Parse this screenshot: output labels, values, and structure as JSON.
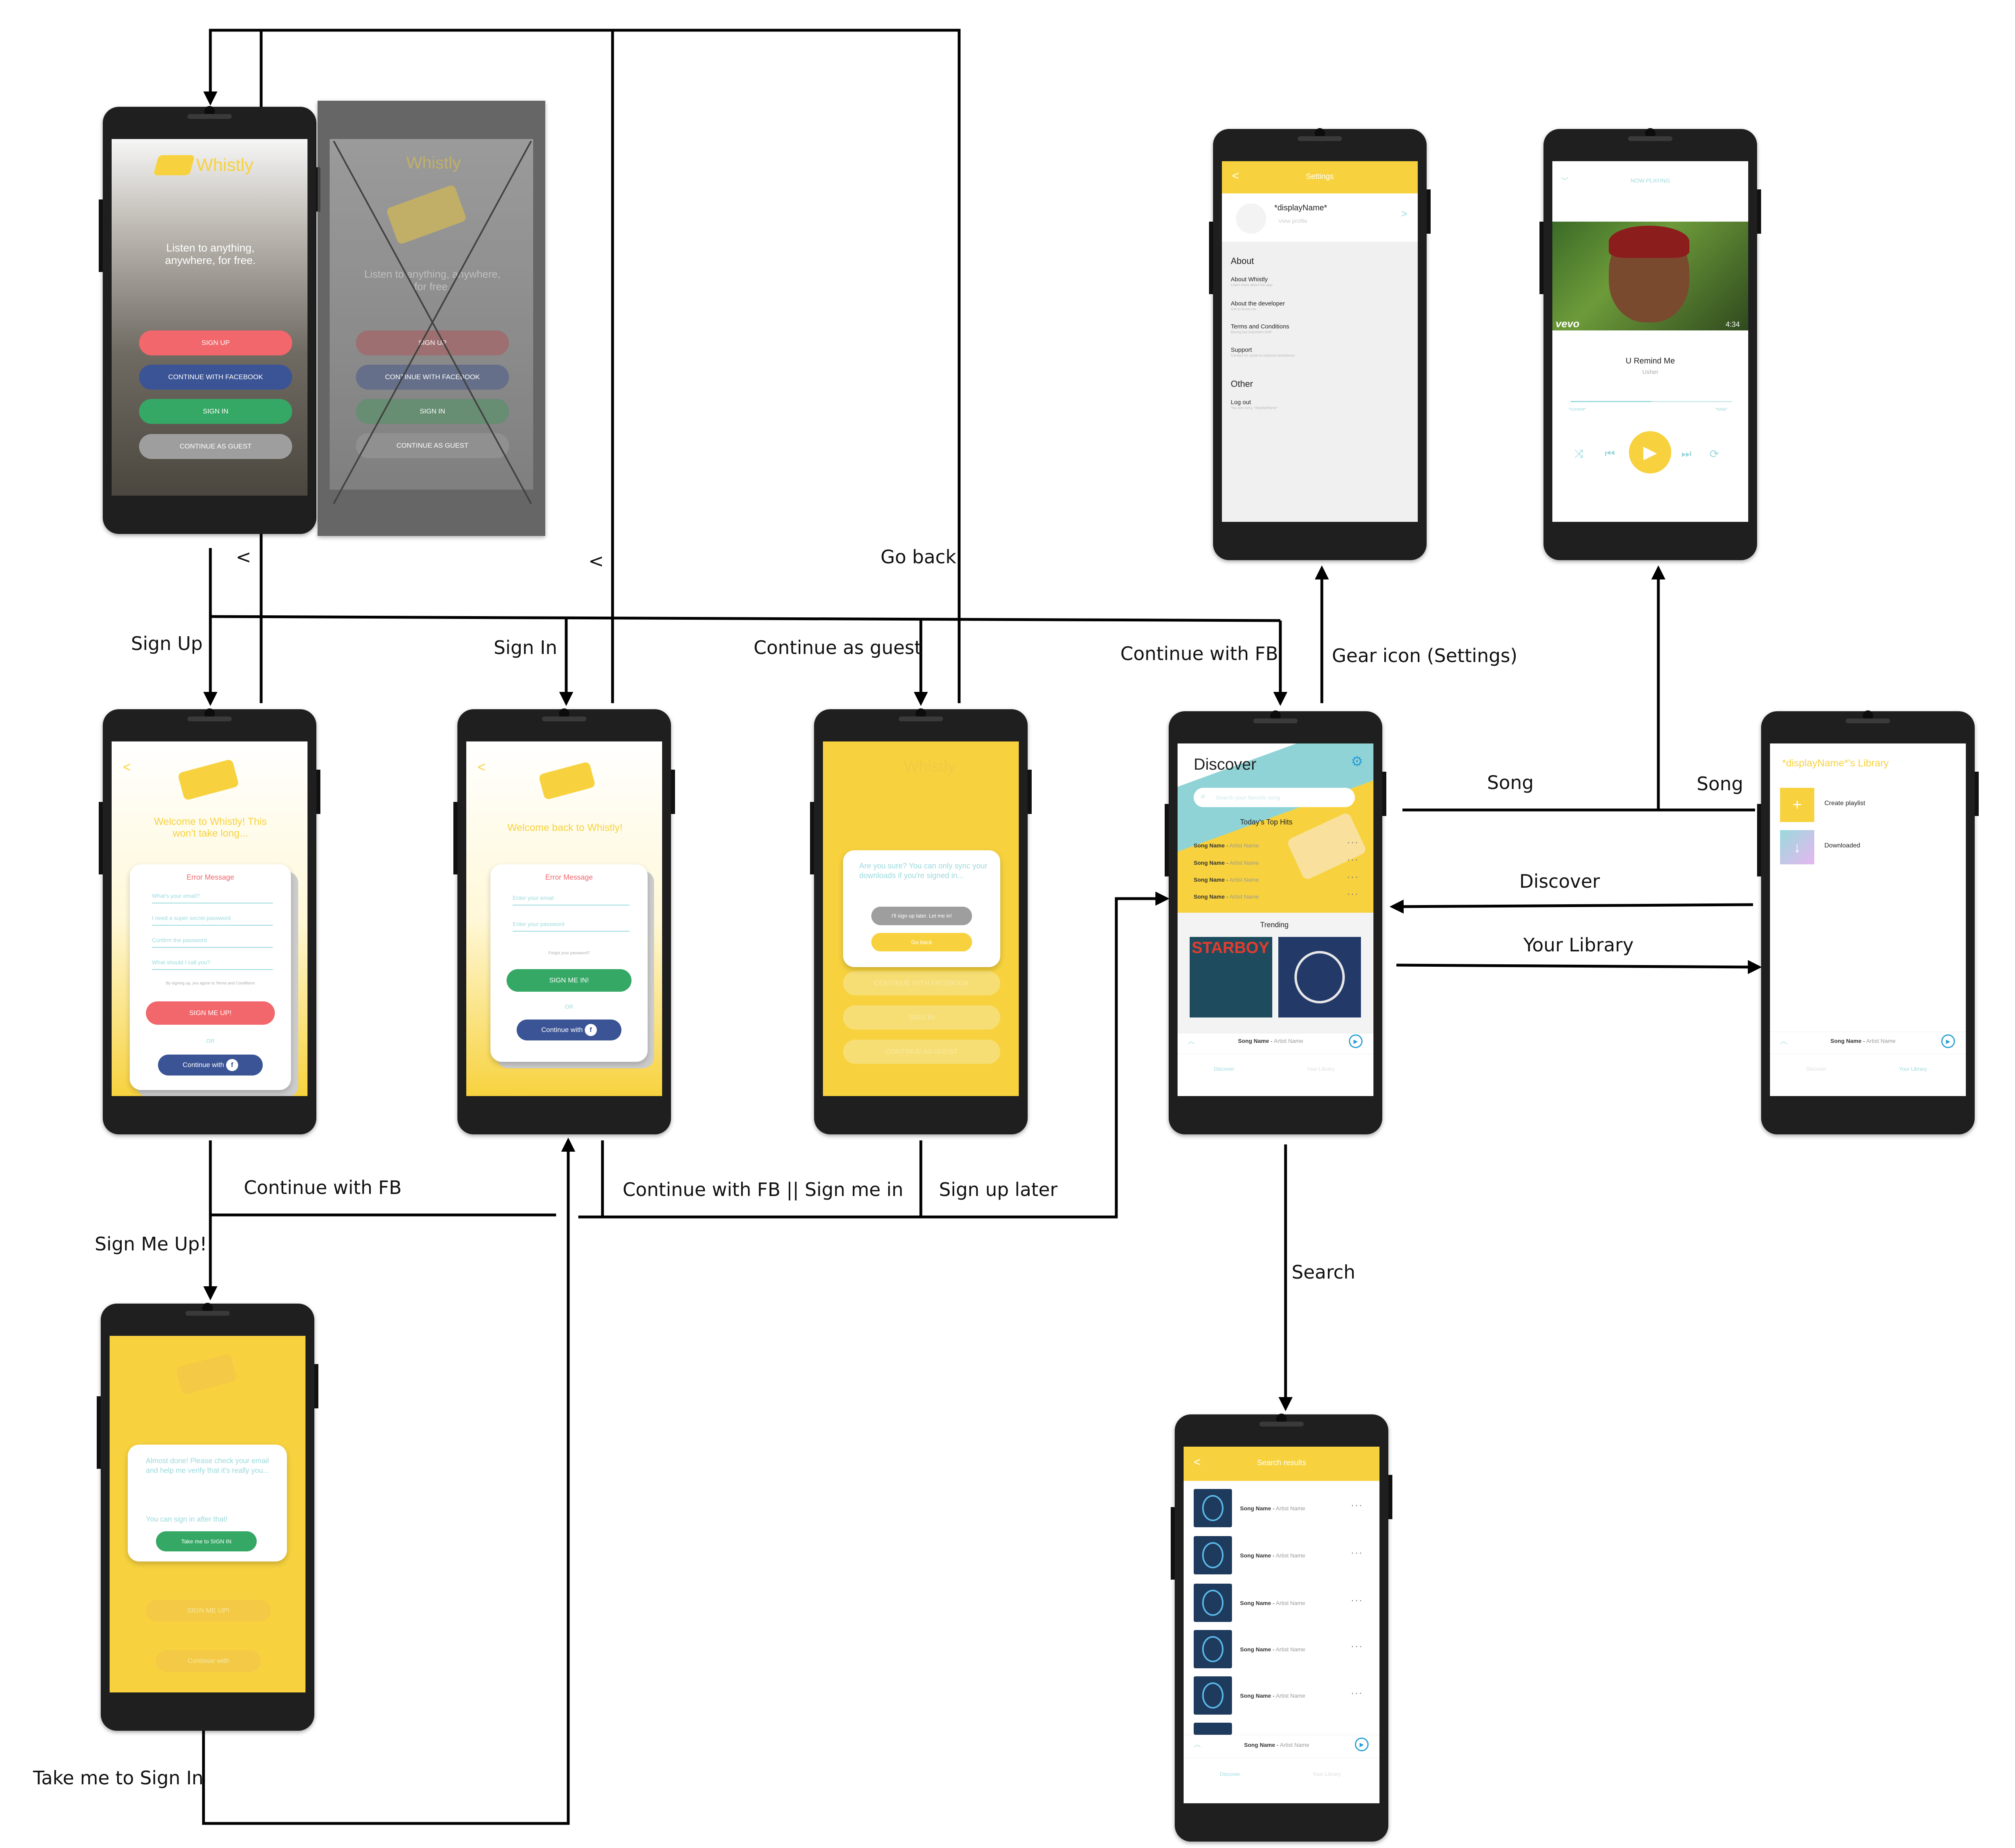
{
  "flow_labels": {
    "back1": "<",
    "back2": "<",
    "go_back": "Go back",
    "sign_up": "Sign Up",
    "sign_in": "Sign In",
    "continue_as_guest": "Continue as guest",
    "continue_with_fb_top": "Continue with FB",
    "gear_icon": "Gear icon (Settings)",
    "song_left": "Song",
    "song_right": "Song",
    "discover": "Discover",
    "your_library": "Your Library",
    "continue_with_fb_bottom": "Continue with FB",
    "sign_me_up": "Sign Me Up!",
    "continue_fb_or_sign_me_in": "Continue with FB || Sign me in",
    "sign_up_later": "Sign up later",
    "search": "Search",
    "take_me_to_sign_in": "Take me to Sign In"
  },
  "landing": {
    "app_name": "Whistly",
    "tagline": "Listen to anything, anywhere, for free.",
    "sign_up": "SIGN UP",
    "continue_facebook": "CONTINUE WITH FACEBOOK",
    "sign_in": "SIGN IN",
    "continue_guest": "CONTINUE AS GUEST"
  },
  "landing_ghost": {
    "app_name": "Whistly",
    "tagline": "Listen to anything, anywhere, for free.",
    "sign_up": "SIGN UP",
    "continue_facebook": "CONTINUE WITH FACEBOOK",
    "sign_in": "SIGN IN",
    "continue_guest": "CONTINUE AS GUEST"
  },
  "signup": {
    "back": "<",
    "welcome": "Welcome to Whistly! This won't take long...",
    "error": "Error Message",
    "email_placeholder": "What's your email?",
    "password_placeholder": "I need a super secret password",
    "confirm_placeholder": "Confirm the password",
    "name_placeholder": "What should I call you?",
    "terms": "By signing up, you agree to Terms and Conditions",
    "submit": "SIGN ME UP!",
    "or": "OR",
    "continue_with": "Continue with"
  },
  "signin": {
    "back": "<",
    "welcome": "Welcome back to Whistly!",
    "error": "Error Message",
    "email_placeholder": "Enter your email",
    "password_placeholder": "Enter your password",
    "forgot": "Forgot your password?",
    "submit": "SIGN ME IN!",
    "or": "OR",
    "continue_with": "Continue with"
  },
  "guest": {
    "app_name": "Whistly",
    "dialog_text": "Are you sure? You can only sync your downloads if you're signed in...",
    "later_btn": "I'll sign up later. Let me in!",
    "back_btn": "Go back",
    "bg_fb": "CONTINUE WITH FACEBOOK",
    "bg_sign_in": "SIGN IN",
    "bg_guest": "CONTINUE AS GUEST"
  },
  "almost_done": {
    "text": "Almost done! Please check your email and help me verify that it's really you...",
    "sub": "You can sign in after that!",
    "button": "Take me to SIGN IN",
    "bg_sign_up": "SIGN ME UP!",
    "bg_continue": "Continue with"
  },
  "discover": {
    "title": "Discover",
    "search_placeholder": "Search your favorite song",
    "top_hits": "Today's Top Hits",
    "hits": [
      {
        "song": "Song Name",
        "artist": "Artist Name"
      },
      {
        "song": "Song Name",
        "artist": "Artist Name"
      },
      {
        "song": "Song Name",
        "artist": "Artist Name"
      },
      {
        "song": "Song Name",
        "artist": "Artist Name"
      }
    ],
    "trending": "Trending",
    "trending_album_1": "STARBOY",
    "now_song": "Song Name",
    "now_artist": "Artist Name",
    "nav_discover": "Discover",
    "nav_library": "Your Library"
  },
  "settings": {
    "title": "Settings",
    "back": "<",
    "display_name": "*displayName*",
    "view_profile": "View profile",
    "about_header": "About",
    "items": [
      {
        "title": "About Whistly",
        "sub": "Learn more about the app"
      },
      {
        "title": "About the developer",
        "sub": "Get to know me"
      },
      {
        "title": "Terms and Conditions",
        "sub": "Boring but important stuff"
      },
      {
        "title": "Support",
        "sub": "Contact for quick-to-respond assistance"
      }
    ],
    "other_header": "Other",
    "logout": "Log out",
    "logout_sub": "You are sorry, *displayName*"
  },
  "now_playing": {
    "header": "NOW PLAYING",
    "video_brand": "vevo",
    "duration": "4:34",
    "song": "U Remind Me",
    "artist": "Usher",
    "current": "*current*",
    "total": "*total*"
  },
  "library": {
    "title": "*displayName*'s Library",
    "create_playlist": "Create playlist",
    "downloaded": "Downloaded",
    "now_song": "Song Name",
    "now_artist": "Artist Name",
    "nav_discover": "Discover",
    "nav_library": "Your Library"
  },
  "search_results": {
    "title": "Search results",
    "back": "<",
    "rows": [
      {
        "song": "Song Name",
        "artist": "Artist Name"
      },
      {
        "song": "Song Name",
        "artist": "Artist Name"
      },
      {
        "song": "Song Name",
        "artist": "Artist Name"
      },
      {
        "song": "Song Name",
        "artist": "Artist Name"
      },
      {
        "song": "Song Name",
        "artist": "Artist Name"
      }
    ],
    "now_song": "Song Name",
    "now_artist": "Artist Name",
    "nav_discover": "Discover",
    "nav_library": "Your Library"
  },
  "colors": {
    "yellow": "#f7d23e",
    "red": "#f2676b",
    "blue": "#3b5495",
    "green": "#36a865",
    "teal": "#9ad9dc"
  }
}
